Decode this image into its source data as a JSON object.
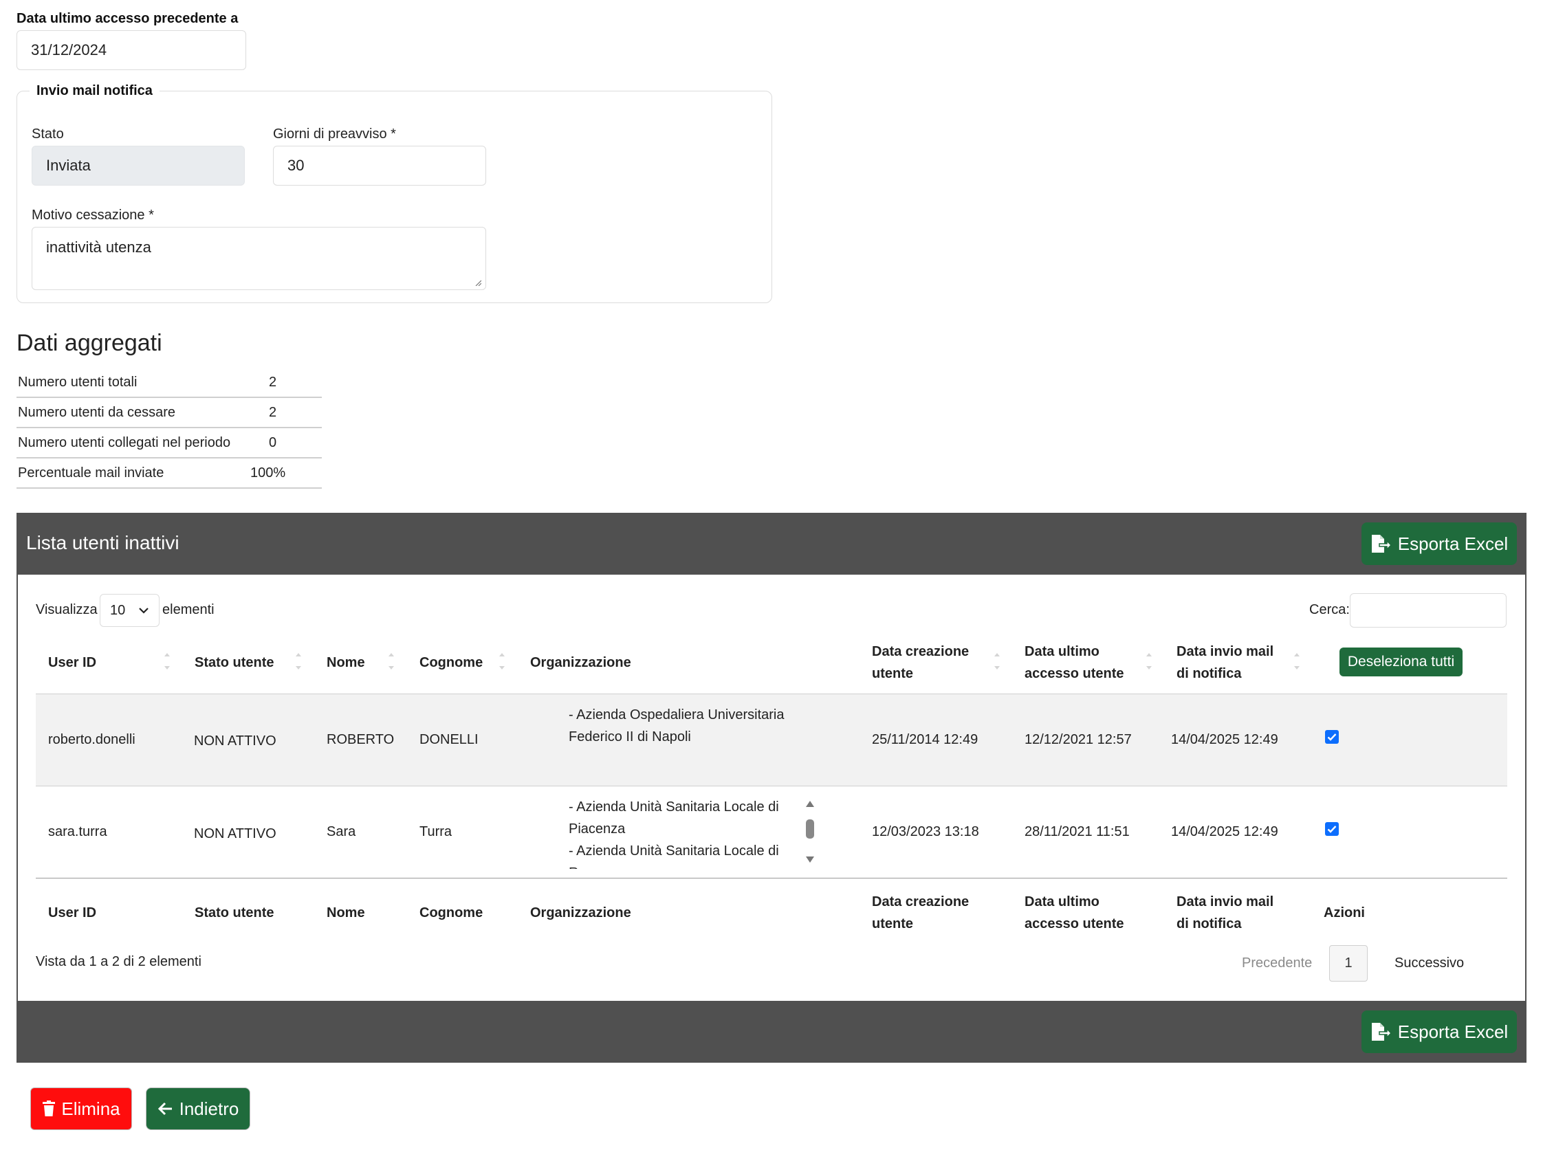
{
  "filters": {
    "last_access_label": "Data ultimo accesso precedente a",
    "last_access_value": "31/12/2024"
  },
  "notify": {
    "legend": "Invio mail notifica",
    "stato_label": "Stato",
    "stato_value": "Inviata",
    "giorni_label": "Giorni di preavviso *",
    "giorni_value": "30",
    "motivo_label": "Motivo cessazione *",
    "motivo_value": "inattività utenza"
  },
  "aggregates": {
    "title": "Dati aggregati",
    "rows": [
      {
        "label": "Numero utenti totali",
        "value": "2"
      },
      {
        "label": "Numero utenti da cessare",
        "value": "2"
      },
      {
        "label": "Numero utenti collegati nel periodo",
        "value": "0"
      },
      {
        "label": "Percentuale mail inviate",
        "value": "100%"
      }
    ]
  },
  "list": {
    "title": "Lista utenti inattivi",
    "export_label": "Esporta Excel",
    "show_label": "Visualizza",
    "show_value": "10",
    "elements_label": "elementi",
    "search_label": "Cerca:",
    "search_value": "",
    "deselect_label": "Deseleziona tutti",
    "headers": {
      "user_id": "User ID",
      "stato": "Stato utente",
      "nome": "Nome",
      "cognome": "Cognome",
      "org": "Organizzazione",
      "creazione_1": "Data creazione",
      "creazione_2": "utente",
      "accesso_1": "Data ultimo",
      "accesso_2": "accesso utente",
      "invio_1": "Data invio mail",
      "invio_2": "di notifica",
      "azioni": "Azioni"
    },
    "rows": [
      {
        "user_id": "roberto.donelli",
        "stato": "NON ATTIVO",
        "nome": "ROBERTO",
        "cognome": "DONELLI",
        "org_lines": [
          "- Azienda Ospedaliera Universitaria",
          "Federico II di Napoli"
        ],
        "creazione": "25/11/2014 12:49",
        "accesso": "12/12/2021 12:57",
        "invio": "14/04/2025 12:49",
        "selected": true
      },
      {
        "user_id": "sara.turra",
        "stato": "NON ATTIVO",
        "nome": "Sara",
        "cognome": "Turra",
        "org_lines": [
          "- Azienda Unità Sanitaria Locale di",
          "Piacenza",
          "- Azienda Unità Sanitaria Locale di",
          "R"
        ],
        "creazione": "12/03/2023 13:18",
        "accesso": "28/11/2021 11:51",
        "invio": "14/04/2025 12:49",
        "selected": true
      }
    ],
    "info": "Vista da 1 a 2 di 2 elementi",
    "prev_label": "Precedente",
    "page": "1",
    "next_label": "Successivo"
  },
  "actions": {
    "delete_label": "Elimina",
    "back_label": "Indietro"
  },
  "colors": {
    "green": "#1f6b3c",
    "red": "#ff0d0d",
    "panel": "#505050",
    "checkbox": "#0d6efd"
  }
}
